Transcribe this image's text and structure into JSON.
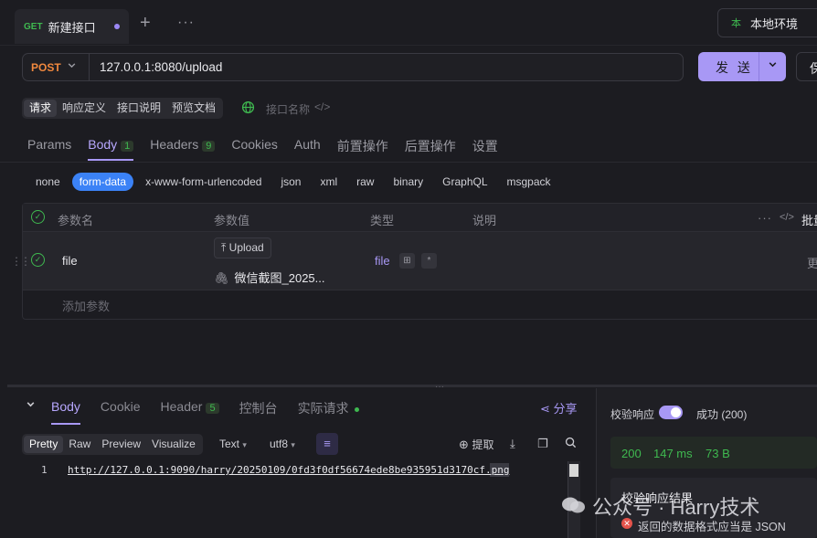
{
  "top_tabs": {
    "active": {
      "method": "GET",
      "title": "新建接口"
    },
    "add": "+",
    "more": "···",
    "environment": {
      "icon": "本",
      "label": "本地环境"
    }
  },
  "request_bar": {
    "method": "POST",
    "url": "127.0.0.1:8080/upload",
    "send_label": "发 送",
    "save_label": "保"
  },
  "segments": [
    "请求",
    "响应定义",
    "接口说明",
    "预览文档"
  ],
  "name_placeholder": "接口名称",
  "request_tabs": [
    {
      "label": "Params"
    },
    {
      "label": "Body",
      "count": "1"
    },
    {
      "label": "Headers",
      "count": "9"
    },
    {
      "label": "Cookies"
    },
    {
      "label": "Auth"
    },
    {
      "label": "前置操作"
    },
    {
      "label": "后置操作"
    },
    {
      "label": "设置"
    }
  ],
  "body_types": [
    "none",
    "form-data",
    "x-www-form-urlencoded",
    "json",
    "xml",
    "raw",
    "binary",
    "GraphQL",
    "msgpack"
  ],
  "params_table": {
    "headers": {
      "name": "参数名",
      "value": "参数值",
      "type": "类型",
      "desc": "说明",
      "bulk": "批量"
    },
    "row": {
      "name": "file",
      "upload_label": "Upload",
      "file_value": "微信截图_2025...",
      "type": "file",
      "more": "更"
    },
    "add_param": "添加参数"
  },
  "response": {
    "tabs": [
      {
        "label": "Body"
      },
      {
        "label": "Cookie"
      },
      {
        "label": "Header",
        "count": "5"
      },
      {
        "label": "控制台"
      },
      {
        "label": "实际请求"
      }
    ],
    "share": "分享",
    "formats": [
      "Pretty",
      "Raw",
      "Preview",
      "Visualize"
    ],
    "text_dropdown": "Text",
    "encoding": "utf8",
    "extract": "提取",
    "line_number": "1",
    "body_line": "http://127.0.0.1:9090/harry/20250109/0fd3f0df56674ede8be935951d3170cf.png"
  },
  "validation": {
    "label": "校验响应",
    "status": "成功 (200)",
    "code": "200",
    "time": "147 ms",
    "size": "73 B",
    "result_title": "校验响应结果",
    "error": "返回的数据格式应当是 JSON"
  },
  "watermark": "公众号 · Harry技术",
  "colors": {
    "accent": "#a898f5",
    "success": "#3fb950",
    "post": "#f0883e",
    "error": "#e5534b",
    "form_data": "#3b82f6"
  }
}
